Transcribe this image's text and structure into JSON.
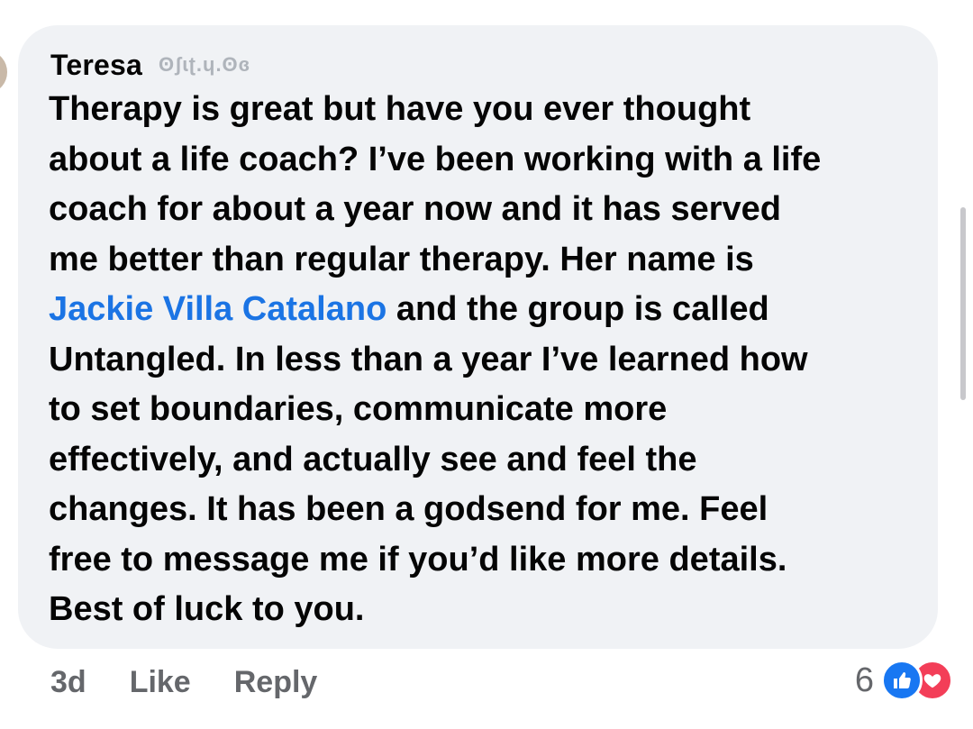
{
  "comment": {
    "author": "Teresa",
    "author_badge": "ʘʃɩʈ.ɥ.ʘɞ",
    "lines": [
      {
        "text": "Therapy is great but have you ever thought"
      },
      {
        "text": "about a life coach? I’ve been working with a life"
      },
      {
        "text": "coach for about a year now and it has served"
      },
      {
        "text": "me better than regular therapy. Her name is"
      },
      {
        "mention": "Jackie Villa Catalano",
        "text": " and the group is called"
      },
      {
        "text": "Untangled. In less than a year I’ve learned how"
      },
      {
        "text": "to set boundaries, communicate more"
      },
      {
        "text": "effectively, and actually see and feel the"
      },
      {
        "text": "changes. It has been a godsend for me. Feel"
      },
      {
        "text": "free to message me if you’d like more details."
      },
      {
        "text": "Best of luck to you."
      }
    ],
    "mention_color": "#1b74e4"
  },
  "actions": {
    "time": "3d",
    "like_label": "Like",
    "reply_label": "Reply"
  },
  "reactions": {
    "count": "6",
    "icons": [
      "like-icon",
      "love-icon"
    ],
    "like_color": "#1877f2",
    "love_color": "#f33e58"
  },
  "colors": {
    "bubble": "#f0f2f5",
    "text": "#050505",
    "muted": "#65676b"
  }
}
